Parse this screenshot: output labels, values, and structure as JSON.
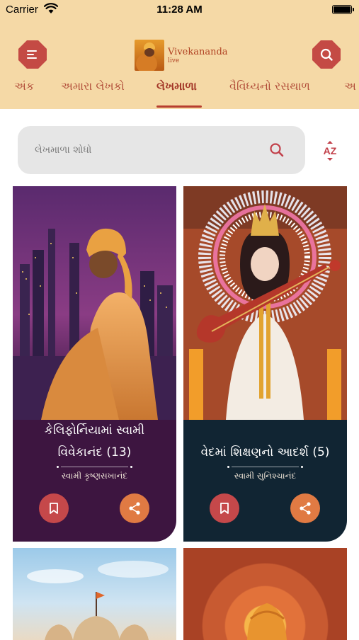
{
  "status_bar": {
    "carrier": "Carrier",
    "time": "11:28 AM"
  },
  "header": {
    "logo_name": "Vivekananda",
    "logo_sub": "live",
    "tabs": [
      {
        "label": "અંક"
      },
      {
        "label": "અમારા લેખકો"
      },
      {
        "label": "લેખમાળા"
      },
      {
        "label": "વૈવિધ્યનો રસથાળ"
      },
      {
        "label": "અ"
      }
    ],
    "active_tab": "લેખમાળા"
  },
  "search": {
    "placeholder": "લેખમાળા શોધો",
    "sort_label": "AZ"
  },
  "cards": [
    {
      "title_line1": "કેલિફોર્નિયામાં સ્વામી",
      "title_line2": "વિવેકાનંદ (13)",
      "author": "સ્વામી કૃષ્ણસખાનંદ"
    },
    {
      "title_line1": "વેદમાં શિક્ષણનો આદર્શ (5)",
      "author": "સ્વામી સુનિશ્ચાનંદ"
    }
  ],
  "colors": {
    "header_bg": "#f5d9a6",
    "accent": "#c44a44",
    "card1_bg": "#3d1540",
    "card2_bg": "#112533",
    "share_btn": "#e07a43"
  },
  "icons": [
    "wifi-icon",
    "battery-icon",
    "menu-icon",
    "search-icon",
    "sort-az-icon",
    "bookmark-icon",
    "share-icon"
  ]
}
